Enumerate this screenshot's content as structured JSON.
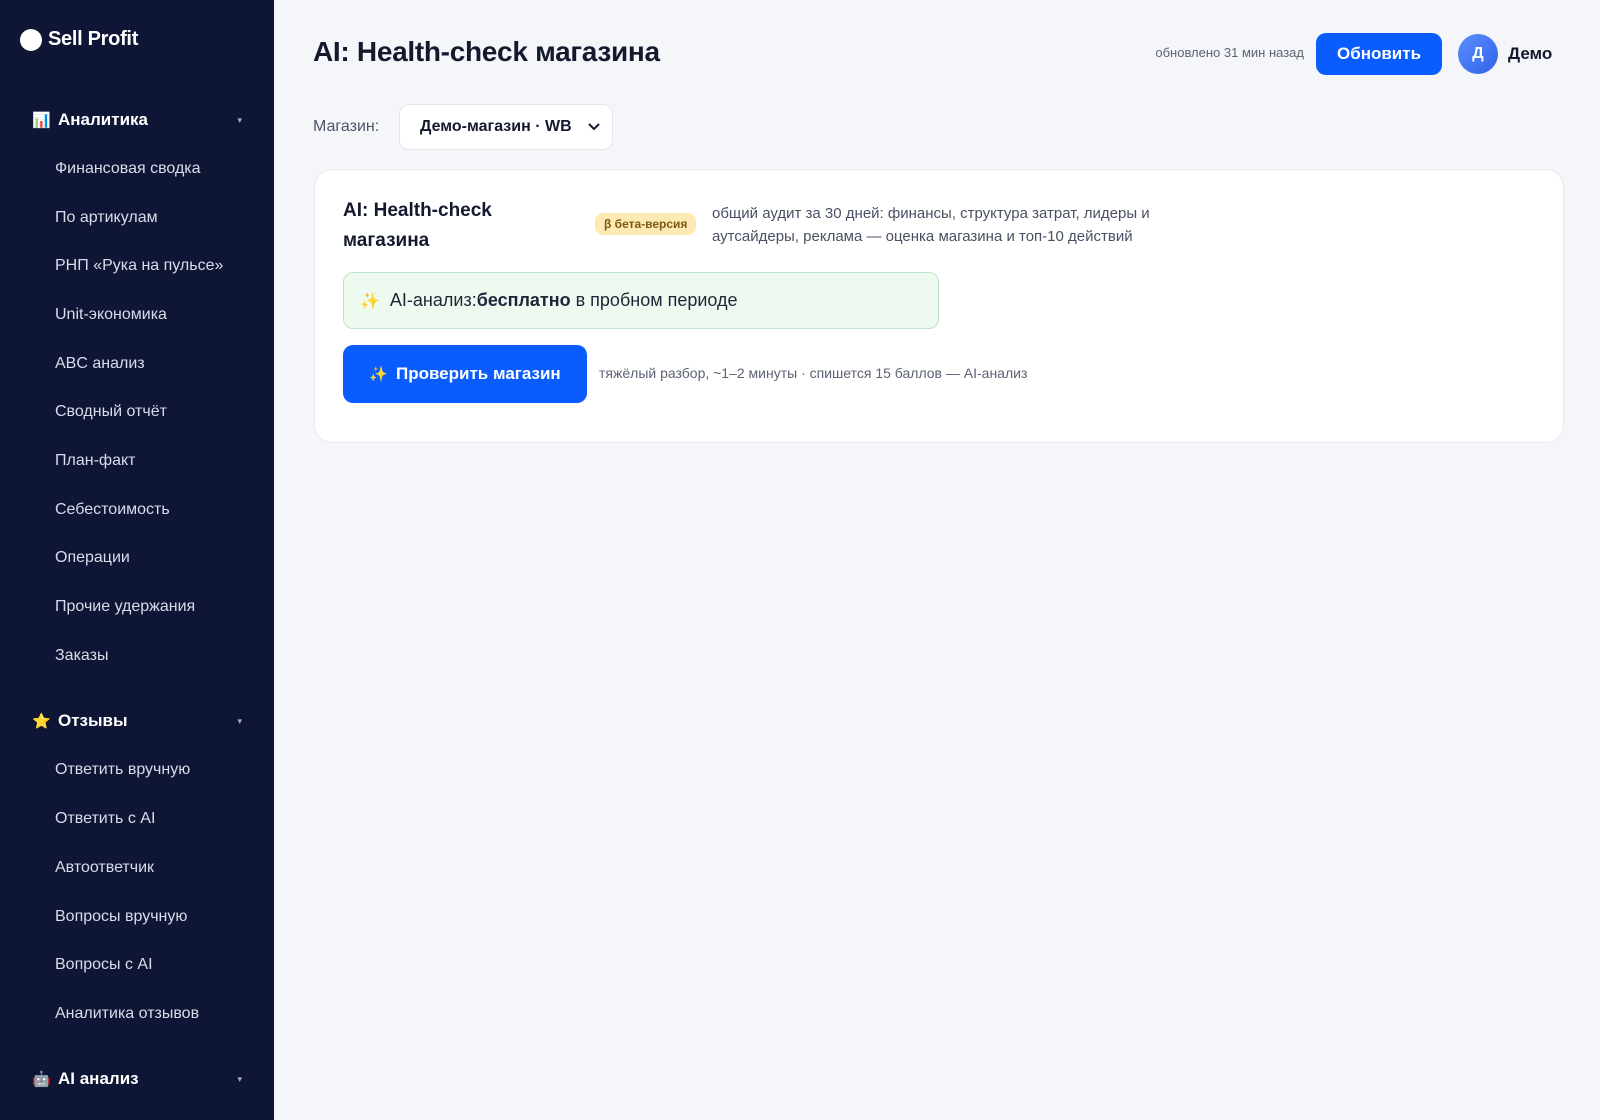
{
  "app": {
    "logo_text": "Sell Profit"
  },
  "sidebar": {
    "groups": [
      {
        "icon": "📊",
        "icon_name": "chart-icon",
        "label": "Аналитика",
        "items": [
          "Финансовая сводка",
          "По артикулам",
          "РНП «Рука на пульсе»",
          "Unit-экономика",
          "ABC анализ",
          "Сводный отчёт",
          "План-факт",
          "Себестоимость",
          "Операции",
          "Прочие удержания",
          "Заказы"
        ]
      },
      {
        "icon": "⭐",
        "icon_name": "star-icon",
        "label": "Отзывы",
        "items": [
          "Ответить вручную",
          "Ответить с AI",
          "Автоответчик",
          "Вопросы вручную",
          "Вопросы с AI",
          "Аналитика отзывов"
        ]
      },
      {
        "icon": "🤖",
        "icon_name": "robot-icon",
        "label": "AI анализ",
        "items": []
      }
    ],
    "chevron": "▾"
  },
  "header": {
    "title": "AI: Health-check магазина",
    "updated_text": "обновлено 31 мин назад",
    "refresh_label": "Обновить",
    "avatar_letter": "Д",
    "user_name": "Демо"
  },
  "store": {
    "label": "Магазин:",
    "selected": "Демо-магазин · WB"
  },
  "card": {
    "title": "AI: Health-check магазина",
    "badge": "β бета-версия",
    "description": "общий аудит за 30 дней: финансы, структура затрат, лидеры и аутсайдеры, реклама — оценка магазина и топ-10 действий",
    "trial_prefix": "AI-анализ: ",
    "trial_bold": "бесплатно",
    "trial_suffix": " в пробном периоде",
    "check_label": "Проверить магазин",
    "check_note": "тяжёлый разбор, ~1–2 минуты · спишется 15 баллов — AI-анализ"
  },
  "colors": {
    "sidebar_bg": "#0f1535",
    "accent": "#0a5cff",
    "page_bg": "#f5f6fa",
    "badge_bg": "#fde9b4",
    "trial_bg": "#eefaf0"
  }
}
